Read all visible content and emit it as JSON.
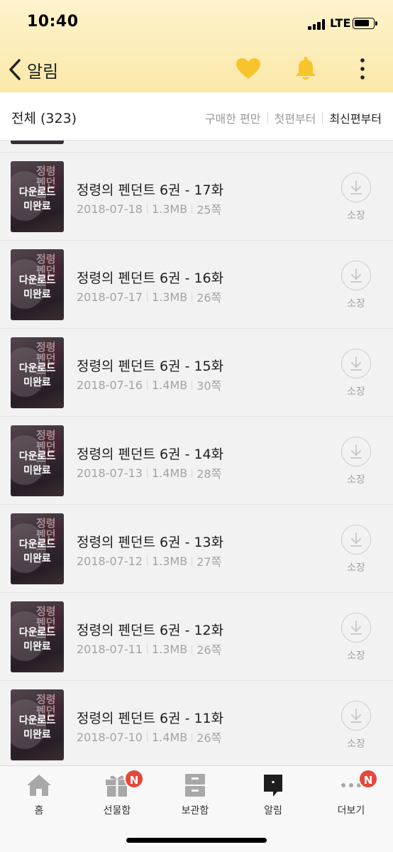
{
  "status": {
    "time": "10:40",
    "network": "LTE"
  },
  "nav": {
    "back_label": "알림"
  },
  "filter": {
    "total": "전체 (323)",
    "options": [
      {
        "label": "구매한 편만",
        "active": false
      },
      {
        "label": "첫편부터",
        "active": false
      },
      {
        "label": "최신편부터",
        "active": true
      }
    ]
  },
  "episodes": [
    {
      "title": "정령의 펜던트 6권 - 17화",
      "date": "2018-07-18",
      "size": "1.3MB",
      "pages": "25쪽"
    },
    {
      "title": "정령의 펜던트 6권 - 16화",
      "date": "2018-07-17",
      "size": "1.3MB",
      "pages": "26쪽"
    },
    {
      "title": "정령의 펜던트 6권 - 15화",
      "date": "2018-07-16",
      "size": "1.4MB",
      "pages": "30쪽"
    },
    {
      "title": "정령의 펜던트 6권 - 14화",
      "date": "2018-07-13",
      "size": "1.4MB",
      "pages": "28쪽"
    },
    {
      "title": "정령의 펜던트 6권 - 13화",
      "date": "2018-07-12",
      "size": "1.3MB",
      "pages": "27쪽"
    },
    {
      "title": "정령의 펜던트 6권 - 12화",
      "date": "2018-07-11",
      "size": "1.3MB",
      "pages": "26쪽"
    },
    {
      "title": "정령의 펜던트 6권 - 11화",
      "date": "2018-07-10",
      "size": "1.4MB",
      "pages": "26쪽"
    }
  ],
  "cover": {
    "ghost_title": "정령\n펜던트",
    "overlay_line1": "다운로드",
    "overlay_line2": "미완료"
  },
  "own_label": "소장",
  "tabs": [
    {
      "label": "홈",
      "icon": "home-icon",
      "badge": ""
    },
    {
      "label": "선물함",
      "icon": "gift-icon",
      "badge": "N"
    },
    {
      "label": "보관함",
      "icon": "storage-icon",
      "badge": ""
    },
    {
      "label": "알림",
      "icon": "notification-icon",
      "badge": ""
    },
    {
      "label": "더보기",
      "icon": "more-dots-icon",
      "badge": "N"
    }
  ],
  "colors": {
    "accent_yellow": "#f7c52b",
    "badge_red": "#e4483d",
    "header_bg": "#fbe9a8"
  }
}
